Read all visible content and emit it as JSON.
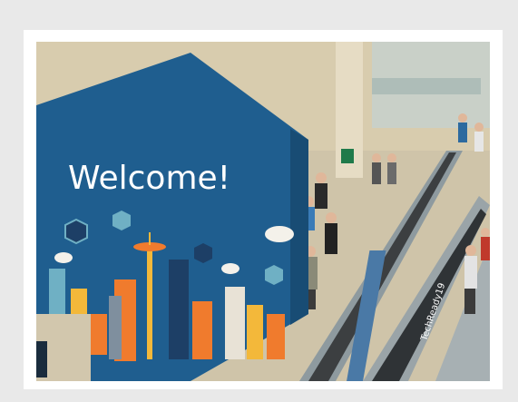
{
  "photo": {
    "banner_text": "Welcome!",
    "escalator_side_text": "TechReady19",
    "colors": {
      "banner_blue": "#1f5e8f",
      "hall_beige": "#cfc4a9",
      "escalator_steel": "#9aa4a8",
      "exit_sign_green": "#1f7a4a",
      "city_orange": "#f07b2d",
      "city_yellow": "#f3b83a",
      "city_navy": "#1d3f66",
      "city_teal": "#6fb0c4"
    }
  }
}
